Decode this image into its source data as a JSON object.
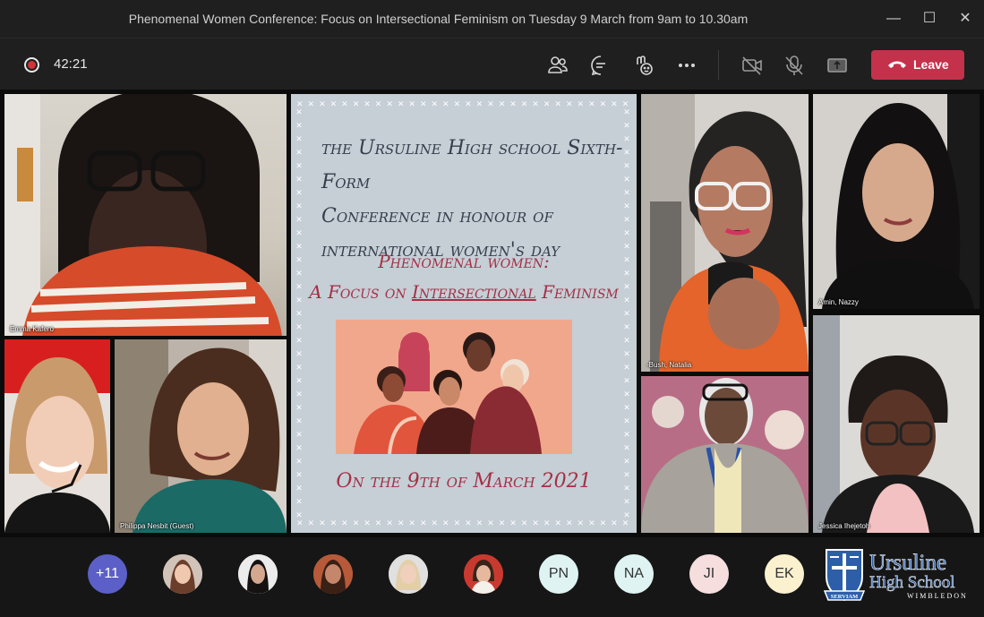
{
  "window": {
    "title": "Phenomenal Women Conference: Focus on Intersectional Feminism on Tuesday 9 March from 9am to 10.30am"
  },
  "toolbar": {
    "timer": "42:21",
    "leave_label": "Leave",
    "leave_color": "#c4314b"
  },
  "participants": {
    "emma": "Emma Kafero",
    "philippa": "Philippa Nesbit (Guest)",
    "natalia": "-Bush, Natalia",
    "nazzy": "Amin, Nazzy",
    "jessica": "Jessica Ihejetoh"
  },
  "slide": {
    "line1": "the Ursuline High school Sixth-Form",
    "line2": "Conference in honour of",
    "line3": "international women's day",
    "line4": "Phenomenal women:",
    "line5_pre": "A Focus on ",
    "line5_underlined": "Intersectional",
    "line5_post": " Feminism",
    "line6": "On the 9th of March 2021"
  },
  "tray": {
    "overflow": "+11",
    "initials": [
      "PN",
      "NA",
      "JI",
      "EK"
    ]
  },
  "logo": {
    "line1": "Ursuline",
    "line2": "High School",
    "line3": "WIMBLEDON",
    "motto": "SERVIAM"
  }
}
